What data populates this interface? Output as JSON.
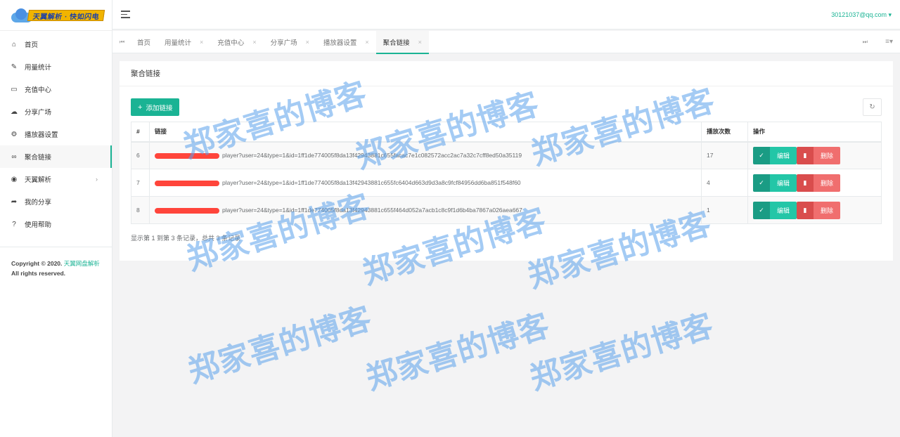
{
  "brand": {
    "logo_text": "天翼解析 · 快如闪电"
  },
  "sidebar": {
    "items": [
      {
        "label": "首页",
        "icon": "home-icon"
      },
      {
        "label": "用量统计",
        "icon": "pencil-icon"
      },
      {
        "label": "充值中心",
        "icon": "credit-card-icon"
      },
      {
        "label": "分享广场",
        "icon": "cloud-icon"
      },
      {
        "label": "播放器设置",
        "icon": "gear-icon"
      },
      {
        "label": "聚合链接",
        "icon": "link-icon"
      },
      {
        "label": "天翼解析",
        "icon": "palette-icon"
      },
      {
        "label": "我的分享",
        "icon": "share-icon"
      },
      {
        "label": "使用帮助",
        "icon": "question-icon"
      }
    ],
    "active_index": 5,
    "copyright_prefix": "Copyright © 2020.",
    "copyright_link": "天翼网盘解析",
    "rights": "All rights reserved."
  },
  "header": {
    "user_email": "30121037@qq.com"
  },
  "tabs": [
    {
      "label": "首页",
      "closable": false
    },
    {
      "label": "用量统计",
      "closable": true
    },
    {
      "label": "充值中心",
      "closable": true
    },
    {
      "label": "分享广场",
      "closable": true
    },
    {
      "label": "播放器设置",
      "closable": true
    },
    {
      "label": "聚合链接",
      "closable": true,
      "active": true
    }
  ],
  "panel": {
    "title": "聚合链接",
    "add_label": "添加链接",
    "columns": [
      "#",
      "链接",
      "播放次数",
      "操作"
    ],
    "rows": [
      {
        "id": "6",
        "link": "player?user=24&type=1&id=1ff1de774005f8da13f42943881c655facac7e1c082572acc2ac7a32c7cff8ed50a35119",
        "plays": "17"
      },
      {
        "id": "7",
        "link": "player?user=24&type=1&id=1ff1de774005f8da13f42943881c655fc6404d663d9d3a8c9fcf84956dd6ba851f548f60",
        "plays": "4"
      },
      {
        "id": "8",
        "link": "player?user=24&type=1&id=1ff1de774005f8da13f42943881c655f464d052a7acb1c8c9f1d6b4ba7867a026aea667",
        "plays": "1"
      }
    ],
    "edit_label": "编辑",
    "delete_label": "删除",
    "pager_info": "显示第 1 到第 3 条记录，总共 3 条记录"
  },
  "watermark": "郑家喜的博客",
  "colors": {
    "accent": "#1ab394",
    "danger": "#ed5565",
    "redaction": "#ff3b30"
  }
}
